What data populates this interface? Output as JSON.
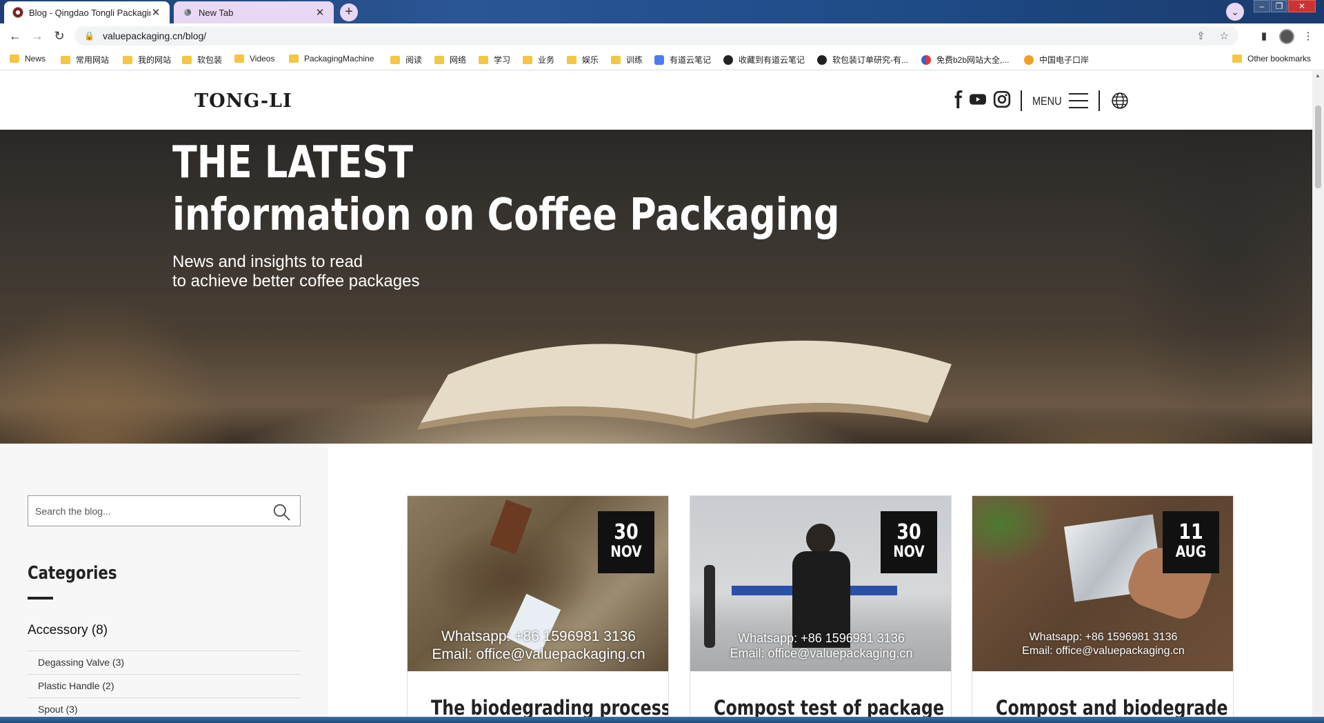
{
  "browser": {
    "tabs": [
      {
        "title": "Blog - Qingdao Tongli Packaging",
        "active": true
      },
      {
        "title": "New Tab",
        "active": false
      }
    ],
    "new_tab_label": "+",
    "url": "valuepackaging.cn/blog/",
    "bookmarks": [
      {
        "label": "News",
        "type": "folder"
      },
      {
        "label": "常用网站",
        "type": "folder"
      },
      {
        "label": "我的网站",
        "type": "folder"
      },
      {
        "label": "软包装",
        "type": "folder"
      },
      {
        "label": "Videos",
        "type": "folder"
      },
      {
        "label": "PackagingMachine",
        "type": "folder"
      },
      {
        "label": "阅读",
        "type": "folder"
      },
      {
        "label": "网络",
        "type": "folder"
      },
      {
        "label": "学习",
        "type": "folder"
      },
      {
        "label": "业务",
        "type": "folder"
      },
      {
        "label": "娱乐",
        "type": "folder"
      },
      {
        "label": "训练",
        "type": "folder"
      },
      {
        "label": "有道云笔记",
        "type": "link"
      },
      {
        "label": "收藏到有道云笔记",
        "type": "link"
      },
      {
        "label": "软包装订单研究-有...",
        "type": "link"
      },
      {
        "label": "免费b2b网站大全,...",
        "type": "link"
      },
      {
        "label": "中国电子口岸",
        "type": "link"
      }
    ],
    "other_bookmarks": "Other bookmarks"
  },
  "header": {
    "logo": "TONG-LI",
    "menu_label": "MENU"
  },
  "hero": {
    "title_line1": "THE LATEST",
    "title_line2": "information on Coffee Packaging",
    "subtitle_line1": "News and insights to read",
    "subtitle_line2": "to achieve better coffee packages"
  },
  "sidebar": {
    "search_placeholder": "Search the blog...",
    "categories_title": "Categories",
    "parent_category": "Accessory (8)",
    "items": [
      {
        "label": "Degassing Valve (3)"
      },
      {
        "label": "Plastic Handle (2)"
      },
      {
        "label": "Spout (3)"
      }
    ]
  },
  "posts": [
    {
      "day": "30",
      "month": "NOV",
      "title": "The biodegrading process",
      "watermark_line1": "Whatsapp: +86 1596981 3136",
      "watermark_line2": "Email: office@valuepackaging.cn"
    },
    {
      "day": "30",
      "month": "NOV",
      "title": "Compost test of package",
      "watermark_line1": "Whatsapp: +86 1596981 3136",
      "watermark_line2": "Email: office@valuepackaging.cn"
    },
    {
      "day": "11",
      "month": "AUG",
      "title": "Compost and biodegrade",
      "watermark_line1": "Whatsapp: +86 1596981 3136",
      "watermark_line2": "Email: office@valuepackaging.cn"
    }
  ],
  "colors": {
    "accent_dark": "#111111",
    "tab_inactive": "#e8d8f3",
    "sidebar_bg": "#f7f7f7"
  }
}
